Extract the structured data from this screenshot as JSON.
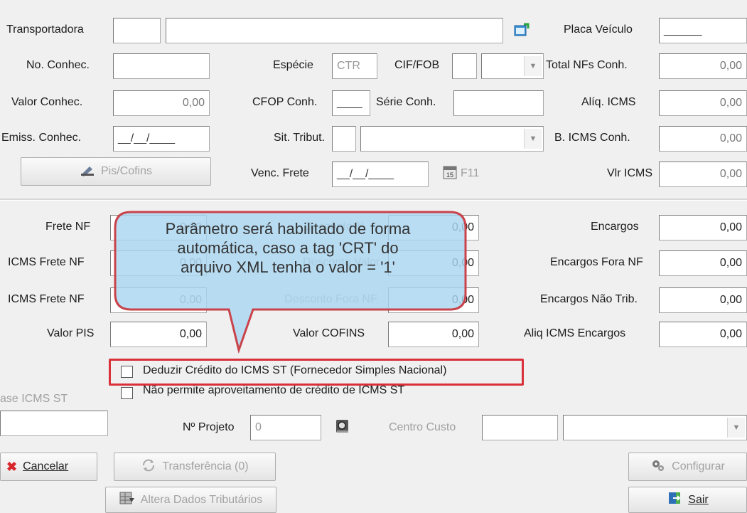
{
  "top": {
    "transportadora_label": "Transportadora",
    "transportadora_code": "",
    "transportadora_name": "",
    "placa_label": "Placa Veículo",
    "placa_value": "______",
    "no_conhec_label": "No. Conhec.",
    "no_conhec_value": "",
    "especie_label": "Espécie",
    "especie_value": "CTR",
    "cif_fob_label": "CIF/FOB",
    "cif_fob_value": "",
    "total_nfs_label": "Total NFs Conh.",
    "total_nfs_value": "0,00",
    "valor_conhec_label": "Valor Conhec.",
    "valor_conhec_value": "0,00",
    "cfop_label": "CFOP Conh.",
    "cfop_value": "____",
    "serie_label": "Série Conh.",
    "serie_value": "",
    "aliq_icms_label": "Alíq. ICMS",
    "aliq_icms_value": "0,00",
    "emiss_label": "Emiss. Conhec.",
    "emiss_value": "__/__/____",
    "sit_trib_label": "Sit. Tribut.",
    "sit_trib_code": "",
    "sit_trib_desc": "",
    "b_icms_label": "B. ICMS Conh.",
    "b_icms_value": "0,00",
    "pis_cofins_label": "Pis/Cofins",
    "venc_frete_label": "Venc. Frete",
    "venc_frete_value": "__/__/____",
    "f11_label": "F11",
    "vlr_icms_label": "Vlr ICMS",
    "vlr_icms_value": "0,00"
  },
  "middle": {
    "frete_nf_label": "Frete NF",
    "frete_nf_value": "0,00",
    "desconto_pct_label": "Desconto %",
    "desconto_pct_value": "0,00",
    "encargos_label": "Encargos",
    "encargos_value": "0,00",
    "icms_frete_nf_label": "ICMS Frete NF",
    "icms_frete_nf_value": "0,00",
    "desconto_valor_label": "Desconto Valor",
    "desconto_valor_value": "0,00",
    "encargos_fora_label": "Encargos Fora NF",
    "encargos_fora_value": "0,00",
    "icms_frete_nf2_label": "ICMS Frete NF",
    "icms_frete_nf2_value": "0,00",
    "desconto_fora_label": "Desconto Fora NF",
    "desconto_fora_value": "0,00",
    "encargos_nao_trib_label": "Encargos Não Trib.",
    "encargos_nao_trib_value": "0,00",
    "valor_pis_label": "Valor PIS",
    "valor_pis_value": "0,00",
    "valor_cofins_label": "Valor COFINS",
    "valor_cofins_value": "0,00",
    "aliq_icms_enc_label": "Aliq ICMS Encargos",
    "aliq_icms_enc_value": "0,00"
  },
  "checks": {
    "deduzir_label": "Deduzir Crédito do ICMS ST (Fornecedor Simples Nacional)",
    "nao_permite_label": "Não permite aproveitamento de crédito de ICMS ST",
    "base_icms_st_label": "ase ICMS ST"
  },
  "projeto": {
    "base_icms_st_value": "",
    "projeto_label": "Nº Projeto",
    "projeto_value": "0",
    "centro_custo_label": "Centro Custo",
    "centro_custo_code": "",
    "centro_custo_desc": ""
  },
  "buttons": {
    "cancelar": "Cancelar",
    "transferencia": "Transferência (0)",
    "configurar": "Configurar",
    "altera_dados": "Altera Dados Tributários",
    "sair": "Sair"
  },
  "callout": {
    "line1": "Parâmetro será habilitado de forma",
    "line2": "automática, caso a tag 'CRT' do",
    "line3": "arquivo XML tenha o valor = '1'"
  },
  "colors": {
    "form_bg": "#f0f0f0",
    "highlight": "#d9303a",
    "callout_fill": "#a9d6f0"
  }
}
